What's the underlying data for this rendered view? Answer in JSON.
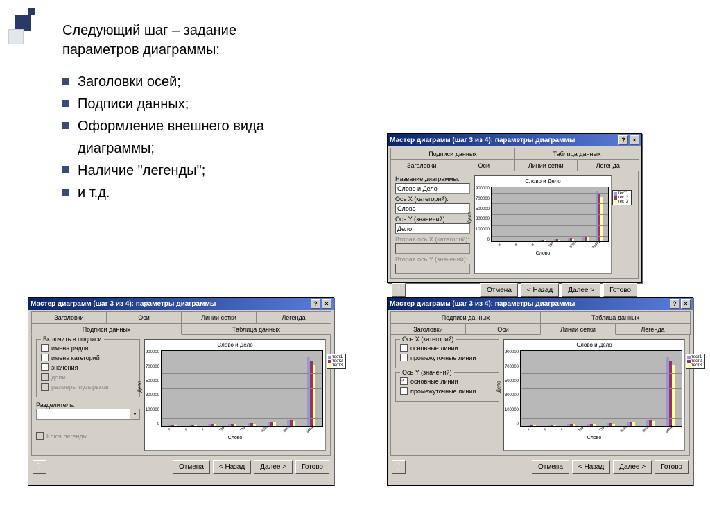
{
  "intro": "Следующий шаг – задание параметров диаграммы:",
  "bullets": [
    "Заголовки осей;",
    "Подписи данных;",
    "Оформление внешнего вида диаграммы;",
    "Наличие \"легенды\";",
    " и т.д."
  ],
  "dialog_title": "Мастер диаграмм (шаг 3 из 4): параметры диаграммы",
  "tabs": {
    "headers": "Заголовки",
    "axes": "Оси",
    "gridlines": "Линии сетки",
    "legend": "Легенда",
    "data_labels": "Подписи данных",
    "data_table": "Таблица данных"
  },
  "fields": {
    "chart_title_lbl": "Название диаграммы:",
    "chart_title_val": "Слово и Дело",
    "x_axis_lbl": "Ось X (категорий):",
    "x_axis_val": "Слово",
    "y_axis_lbl": "Ось Y (значений):",
    "y_axis_val": "Дело",
    "x2_axis_lbl": "Вторая ось X (категорий):",
    "y2_axis_lbl": "Вторая ось Y (значений):"
  },
  "labels_panel": {
    "group_title": "Включить в подписи",
    "series_names": "имена рядов",
    "category_names": "имена категорий",
    "values": "значения",
    "percentages": "доли",
    "bubble_sizes": "размеры пузырьков",
    "separator_lbl": "Разделитель:",
    "legend_key": "Ключ легенды"
  },
  "gridlines_panel": {
    "x_group": "Ось X (категорий)",
    "y_group": "Ось Y (значений)",
    "major": "основные линии",
    "minor": "промежуточные линии"
  },
  "preview": {
    "title": "Слово и Дело",
    "ylabel": "Дело",
    "xlabel": "Слово",
    "legend_items": [
      "тест1",
      "тест2",
      "тест3"
    ]
  },
  "buttons": {
    "cancel": "Отмена",
    "back": "< Назад",
    "next": "Далее >",
    "finish": "Готово",
    "help": "?"
  },
  "chart_data": {
    "type": "bar",
    "title": "Слово и Дело",
    "xlabel": "Слово",
    "ylabel": "Дело",
    "ylim": [
      0,
      1000000
    ],
    "categories": [
      "я",
      "а",
      "и",
      "799",
      "739",
      "8093",
      "9868",
      "39441"
    ],
    "series": [
      {
        "name": "тест1",
        "values": [
          10,
          20,
          30,
          50,
          100,
          200,
          400,
          900000
        ]
      },
      {
        "name": "тест2",
        "values": [
          8,
          15,
          28,
          40,
          90,
          180,
          350,
          850000
        ]
      },
      {
        "name": "тест3",
        "values": [
          5,
          12,
          25,
          38,
          85,
          150,
          320,
          800000
        ]
      }
    ]
  }
}
